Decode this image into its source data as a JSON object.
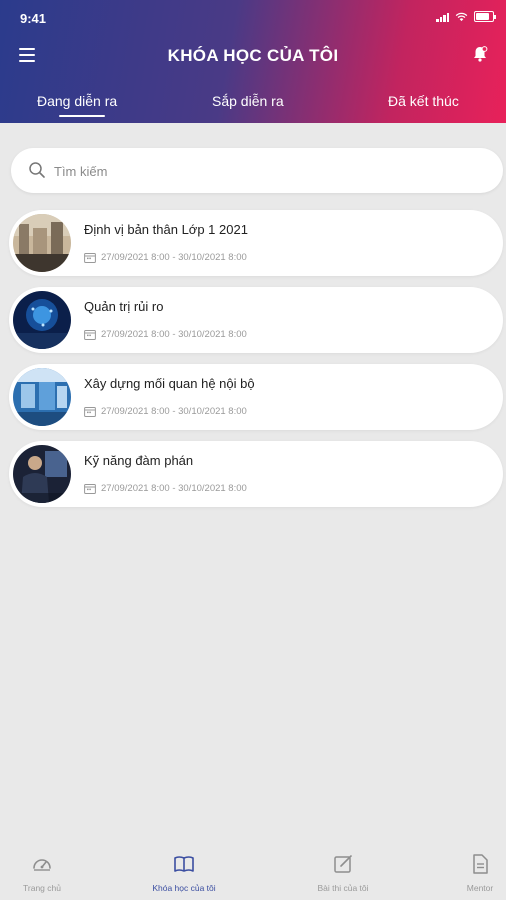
{
  "status": {
    "time": "9:41"
  },
  "header": {
    "title": "KHÓA HỌC CỦA TÔI"
  },
  "tabs": [
    {
      "label": "Đang diễn ra",
      "active": true
    },
    {
      "label": "Sắp diễn ra",
      "active": false
    },
    {
      "label": "Đã kết thúc",
      "active": false
    }
  ],
  "search": {
    "placeholder": "Tìm kiếm",
    "value": ""
  },
  "courses": [
    {
      "title": "Định vị bản thân Lớp 1 2021",
      "date": "27/09/2021 8:00 - 30/10/2021 8:00"
    },
    {
      "title": "Quản trị rủi ro",
      "date": "27/09/2021 8:00 - 30/10/2021 8:00"
    },
    {
      "title": "Xây dựng mối quan hệ nội bộ",
      "date": "27/09/2021 8:00 - 30/10/2021 8:00"
    },
    {
      "title": "Kỹ năng đàm phán",
      "date": "27/09/2021 8:00 - 30/10/2021 8:00"
    }
  ],
  "bottom_nav": [
    {
      "label": "Trang chủ",
      "icon": "dashboard-icon",
      "active": false
    },
    {
      "label": "Khóa học của tôi",
      "icon": "book-icon",
      "active": true
    },
    {
      "label": "Bài thi của tôi",
      "icon": "edit-icon",
      "active": false
    },
    {
      "label": "Mentor",
      "icon": "document-icon",
      "active": false
    }
  ],
  "colors": {
    "header_gradient_start": "#2b3b8c",
    "header_gradient_end": "#e8215a",
    "accent": "#3b4ea1",
    "background": "#e9e9e9"
  }
}
